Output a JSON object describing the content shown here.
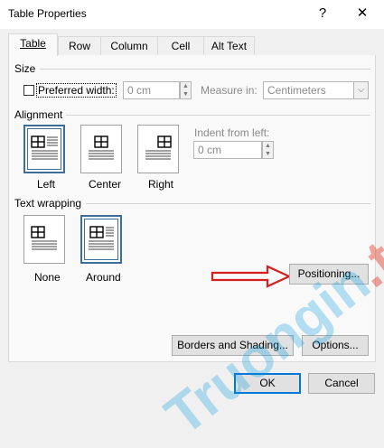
{
  "window": {
    "title": "Table Properties",
    "help_glyph": "?",
    "close_glyph": "✕"
  },
  "tabs": [
    {
      "label": "Table",
      "mnemonic_index": 0,
      "active": true
    },
    {
      "label": "Row",
      "mnemonic_index": 0,
      "active": false
    },
    {
      "label": "Column",
      "mnemonic_index": 0,
      "active": false
    },
    {
      "label": "Cell",
      "mnemonic_index": 1,
      "active": false
    },
    {
      "label": "Alt Text",
      "mnemonic_index": 0,
      "active": false
    }
  ],
  "size": {
    "heading": "Size",
    "preferred_width_label": "Preferred width:",
    "preferred_width_checked": false,
    "width_value": "0 cm",
    "measure_label": "Measure in:",
    "measure_value": "Centimeters"
  },
  "alignment": {
    "heading": "Alignment",
    "options": [
      "Left",
      "Center",
      "Right"
    ],
    "selected": "Left",
    "indent_label": "Indent from left:",
    "indent_value": "0 cm"
  },
  "text_wrapping": {
    "heading": "Text wrapping",
    "options": [
      "None",
      "Around"
    ],
    "selected": "Around",
    "positioning_button": "Positioning..."
  },
  "buttons": {
    "borders": "Borders and Shading...",
    "options": "Options...",
    "ok": "OK",
    "cancel": "Cancel"
  },
  "watermark": {
    "text_main": "Truongin",
    "text_suffix": ".top"
  },
  "colors": {
    "selected_border": "#3c6e98",
    "default_button_border": "#0078d7",
    "arrow": "#d62020"
  }
}
